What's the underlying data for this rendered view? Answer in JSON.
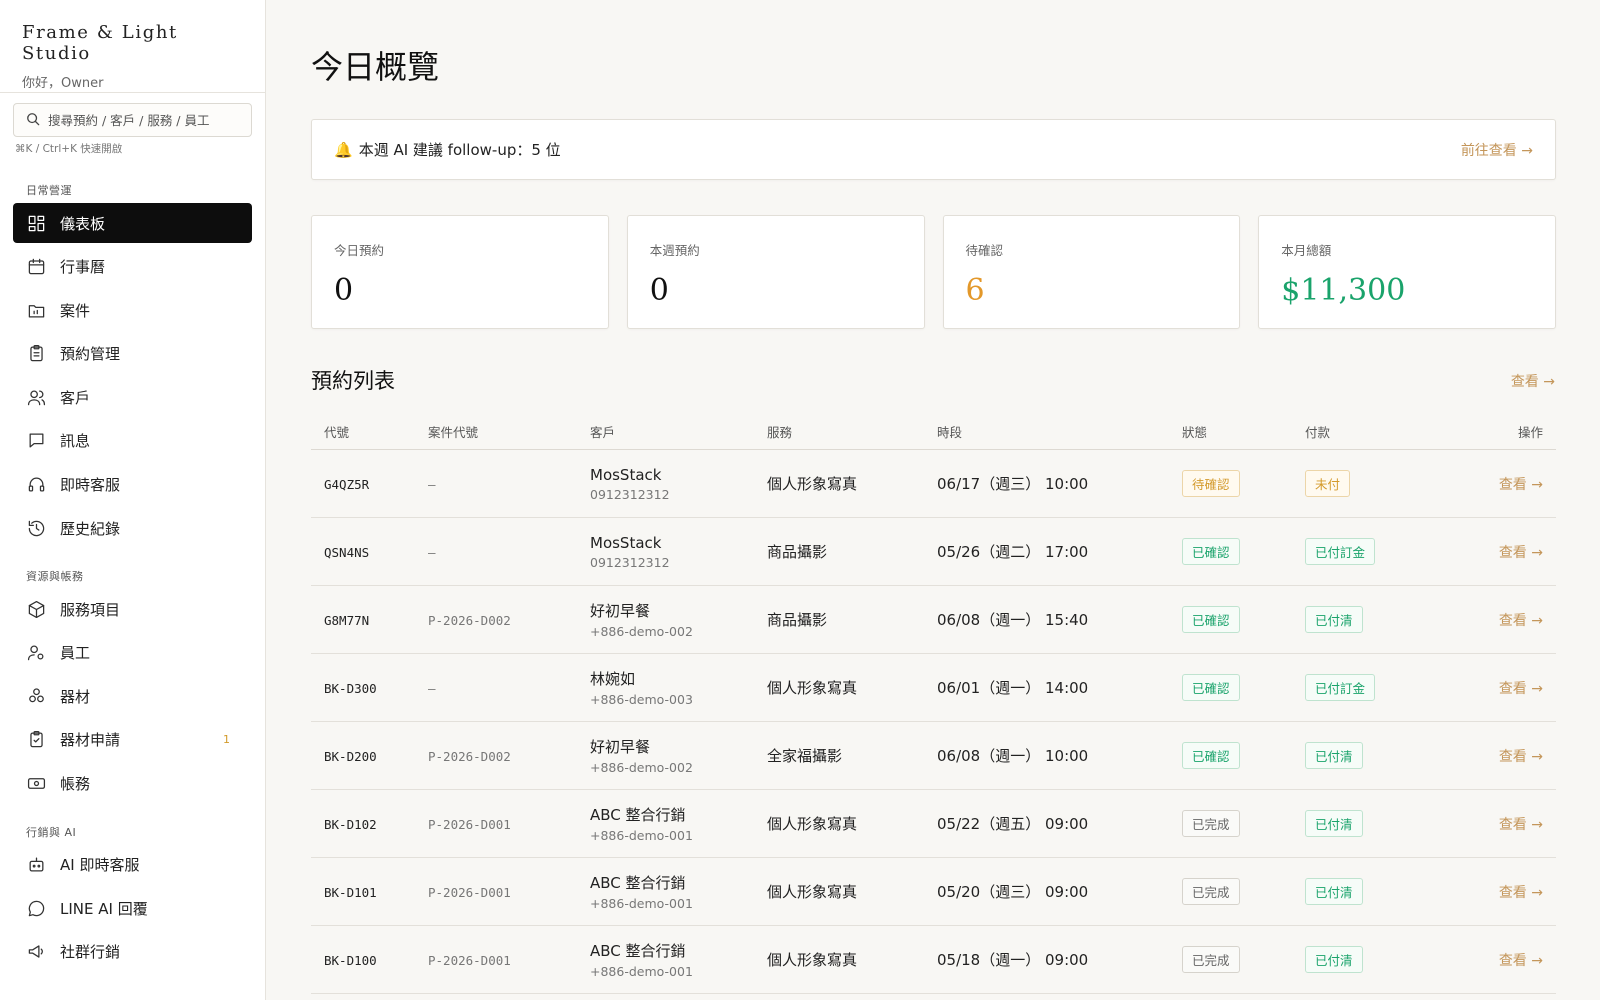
{
  "brand": {
    "name": "Frame & Light Studio",
    "greeting": "你好，Owner"
  },
  "search": {
    "placeholder": "搜尋預約 / 客戶 / 服務 / 員工",
    "hint": "⌘K / Ctrl+K 快速開啟"
  },
  "sidebar": {
    "sections": [
      {
        "label": "日常營運",
        "items": [
          {
            "label": "儀表板",
            "icon": "dashboard-icon",
            "active": true
          },
          {
            "label": "行事曆",
            "icon": "calendar-icon"
          },
          {
            "label": "案件",
            "icon": "folder-icon"
          },
          {
            "label": "預約管理",
            "icon": "clipboard-icon"
          },
          {
            "label": "客戶",
            "icon": "users-icon"
          },
          {
            "label": "訊息",
            "icon": "message-icon"
          },
          {
            "label": "即時客服",
            "icon": "headset-icon"
          },
          {
            "label": "歷史紀錄",
            "icon": "history-icon"
          }
        ]
      },
      {
        "label": "資源與帳務",
        "items": [
          {
            "label": "服務項目",
            "icon": "box-icon"
          },
          {
            "label": "員工",
            "icon": "staff-icon"
          },
          {
            "label": "器材",
            "icon": "equipment-icon"
          },
          {
            "label": "器材申請",
            "icon": "clipboard-check-icon",
            "badge": "1"
          },
          {
            "label": "帳務",
            "icon": "money-icon"
          }
        ]
      },
      {
        "label": "行銷與 AI",
        "items": [
          {
            "label": "AI 即時客服",
            "icon": "bot-icon"
          },
          {
            "label": "LINE AI 回覆",
            "icon": "chat-bubble-icon"
          },
          {
            "label": "社群行銷",
            "icon": "megaphone-icon"
          }
        ]
      }
    ]
  },
  "page": {
    "title": "今日概覽"
  },
  "banner": {
    "text": "本週 AI 建議 follow-up：5 位",
    "link": "前往查看 →",
    "icon": "bell-icon"
  },
  "stats": [
    {
      "label": "今日預約",
      "value": "0",
      "color": "#111111"
    },
    {
      "label": "本週預約",
      "value": "0",
      "color": "#111111"
    },
    {
      "label": "待確認",
      "value": "6",
      "color": "#e3982a"
    },
    {
      "label": "本月總額",
      "value": "$11,300",
      "color": "#1aa36b"
    }
  ],
  "bookings": {
    "title": "預約列表",
    "link": "查看 →",
    "columns": [
      "代號",
      "案件代號",
      "客戶",
      "服務",
      "時段",
      "狀態",
      "付款",
      "操作"
    ],
    "rows": [
      {
        "code": "G4QZ5R",
        "case": "—",
        "client": "MosStack",
        "phone": "0912312312",
        "service": "個人形象寫真",
        "time": "06/17（週三） 10:00",
        "status": "待確認",
        "status_type": "pending",
        "payment": "未付",
        "payment_type": "unpaid",
        "action": "查看 →"
      },
      {
        "code": "QSN4NS",
        "case": "—",
        "client": "MosStack",
        "phone": "0912312312",
        "service": "商品攝影",
        "time": "05/26（週二） 17:00",
        "status": "已確認",
        "status_type": "ok",
        "payment": "已付訂金",
        "payment_type": "ok",
        "action": "查看 →"
      },
      {
        "code": "G8M77N",
        "case": "P-2026-D002",
        "client": "好初早餐",
        "phone": "+886-demo-002",
        "service": "商品攝影",
        "time": "06/08（週一） 15:40",
        "status": "已確認",
        "status_type": "ok",
        "payment": "已付清",
        "payment_type": "ok",
        "action": "查看 →"
      },
      {
        "code": "BK-D300",
        "case": "—",
        "client": "林婉如",
        "phone": "+886-demo-003",
        "service": "個人形象寫真",
        "time": "06/01（週一） 14:00",
        "status": "已確認",
        "status_type": "ok",
        "payment": "已付訂金",
        "payment_type": "ok",
        "action": "查看 →"
      },
      {
        "code": "BK-D200",
        "case": "P-2026-D002",
        "client": "好初早餐",
        "phone": "+886-demo-002",
        "service": "全家福攝影",
        "time": "06/08（週一） 10:00",
        "status": "已確認",
        "status_type": "ok",
        "payment": "已付清",
        "payment_type": "ok",
        "action": "查看 →"
      },
      {
        "code": "BK-D102",
        "case": "P-2026-D001",
        "client": "ABC 整合行銷",
        "phone": "+886-demo-001",
        "service": "個人形象寫真",
        "time": "05/22（週五） 09:00",
        "status": "已完成",
        "status_type": "done",
        "payment": "已付清",
        "payment_type": "ok",
        "action": "查看 →"
      },
      {
        "code": "BK-D101",
        "case": "P-2026-D001",
        "client": "ABC 整合行銷",
        "phone": "+886-demo-001",
        "service": "個人形象寫真",
        "time": "05/20（週三） 09:00",
        "status": "已完成",
        "status_type": "done",
        "payment": "已付清",
        "payment_type": "ok",
        "action": "查看 →"
      },
      {
        "code": "BK-D100",
        "case": "P-2026-D001",
        "client": "ABC 整合行銷",
        "phone": "+886-demo-001",
        "service": "個人形象寫真",
        "time": "05/18（週一） 09:00",
        "status": "已完成",
        "status_type": "done",
        "payment": "已付清",
        "payment_type": "ok",
        "action": "查看 →"
      }
    ]
  }
}
